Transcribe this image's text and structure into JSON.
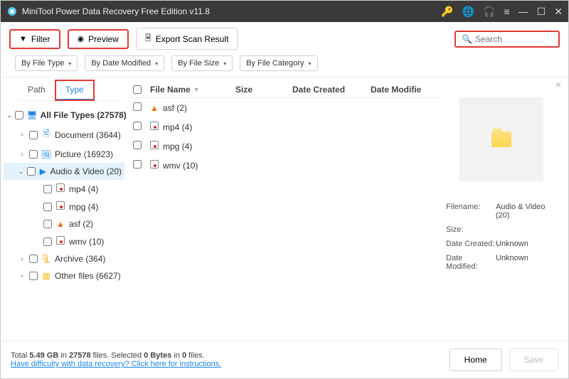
{
  "titlebar": {
    "title": "MiniTool Power Data Recovery Free Edition v11.8"
  },
  "toolbar": {
    "filter": "Filter",
    "preview": "Preview",
    "export": "Export Scan Result",
    "search_placeholder": "Search"
  },
  "filters": {
    "file_type": "By File Type",
    "date_modified": "By Date Modified",
    "file_size": "By File Size",
    "file_category": "By File Category"
  },
  "tabs": {
    "path": "Path",
    "type": "Type"
  },
  "tree": {
    "all": "All File Types (27578)",
    "document": "Document (3644)",
    "picture": "Picture (16923)",
    "audiovideo": "Audio & Video (20)",
    "mp4": "mp4 (4)",
    "mpg": "mpg (4)",
    "asf": "asf (2)",
    "wmv": "wmv (10)",
    "archive": "Archive (364)",
    "other": "Other files (6627)"
  },
  "columns": {
    "name": "File Name",
    "size": "Size",
    "created": "Date Created",
    "modified": "Date Modifie"
  },
  "rows": {
    "r0": "asf (2)",
    "r1": "mp4 (4)",
    "r2": "mpg (4)",
    "r3": "wmv (10)"
  },
  "preview": {
    "filename_k": "Filename:",
    "filename_v": "Audio & Video (20)",
    "size_k": "Size:",
    "size_v": "",
    "created_k": "Date Created:",
    "created_v": "Unknown",
    "modified_k": "Date Modified:",
    "modified_v": "Unknown"
  },
  "footer": {
    "total_prefix": "Total ",
    "total_size": "5.49 GB",
    "total_mid1": " in ",
    "total_files": "27578",
    "total_mid2": " files.  Selected ",
    "sel_bytes": "0 Bytes",
    "sel_mid": " in ",
    "sel_files": "0",
    "sel_suffix": " files.",
    "help": "Have difficulty with data recovery? Click here for instructions.",
    "home": "Home",
    "save": "Save"
  }
}
